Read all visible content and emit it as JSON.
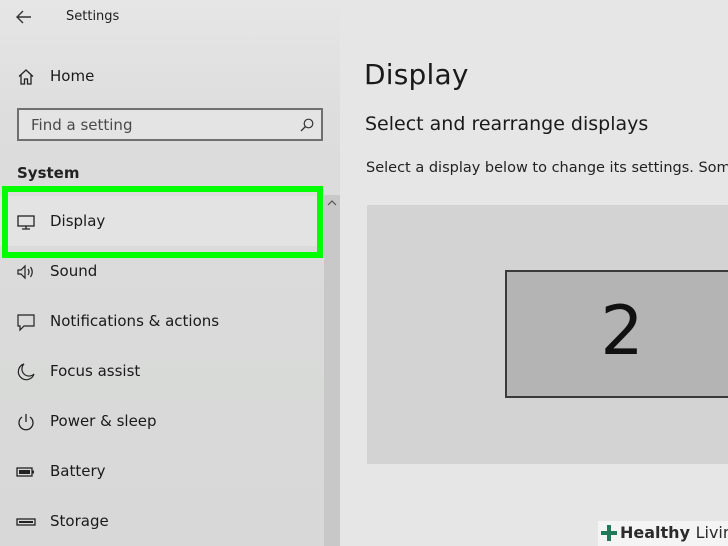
{
  "window": {
    "title": "Settings"
  },
  "sidebar": {
    "home_label": "Home",
    "search": {
      "placeholder": "Find a setting"
    },
    "section_heading": "System",
    "items": [
      {
        "label": "Display",
        "icon": "monitor-icon",
        "active": true
      },
      {
        "label": "Sound",
        "icon": "speaker-icon"
      },
      {
        "label": "Notifications & actions",
        "icon": "message-icon"
      },
      {
        "label": "Focus assist",
        "icon": "moon-icon"
      },
      {
        "label": "Power & sleep",
        "icon": "power-icon"
      },
      {
        "label": "Battery",
        "icon": "battery-icon"
      },
      {
        "label": "Storage",
        "icon": "storage-icon"
      }
    ]
  },
  "main": {
    "title": "Display",
    "subtitle": "Select and rearrange displays",
    "description": "Select a display below to change its settings. Some",
    "display_number": "2"
  },
  "watermark": {
    "bold": "Healthy",
    "light": "Living"
  },
  "colors": {
    "highlight": "#00ff00",
    "sidebar_bg": "#dcdddc",
    "main_bg": "#e6e6e6"
  }
}
